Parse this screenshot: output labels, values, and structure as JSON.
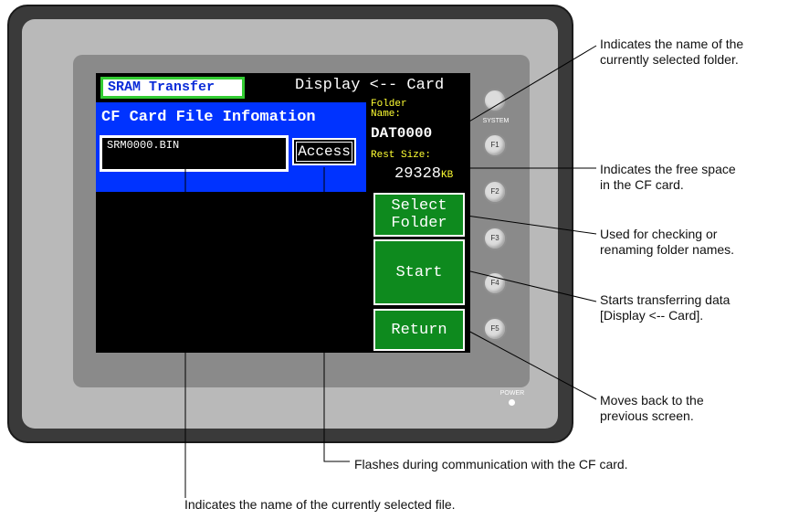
{
  "screen": {
    "title": "SRAM Transfer",
    "direction": "Display <-- Card",
    "panel_title": "CF Card File Infomation",
    "file_name": "SRM0000.BIN",
    "access_label": "Access",
    "folder_label": "Folder\n     Name:",
    "folder_name": "DAT0000",
    "rest_size_label": "Rest Size:",
    "rest_size_value": "29328",
    "rest_size_unit": "KB",
    "buttons": {
      "select_folder": "Select\nFolder",
      "start": "Start",
      "return": "Return"
    }
  },
  "device": {
    "system_label": "SYSTEM",
    "keys": [
      "F1",
      "F2",
      "F3",
      "F4",
      "F5"
    ],
    "power_label": "POWER"
  },
  "callouts": {
    "folder_name": "Indicates the name of the\ncurrently selected folder.",
    "free_space": "Indicates the free space\nin the CF card.",
    "select_folder": "Used for checking or\nrenaming folder names.",
    "start": "Starts transferring data\n[Display <-- Card].",
    "return": "Moves back to the\nprevious screen.",
    "access": "Flashes during communication with the CF card.",
    "file_name": "Indicates the name of the currently selected file."
  },
  "colors": {
    "bezel": "#3a3a3a",
    "face": "#b9b9b9",
    "panel_blue": "#0033ff",
    "button_green": "#0e8a1e",
    "title_border_green": "#33cc33",
    "label_yellow": "#ffff33"
  }
}
